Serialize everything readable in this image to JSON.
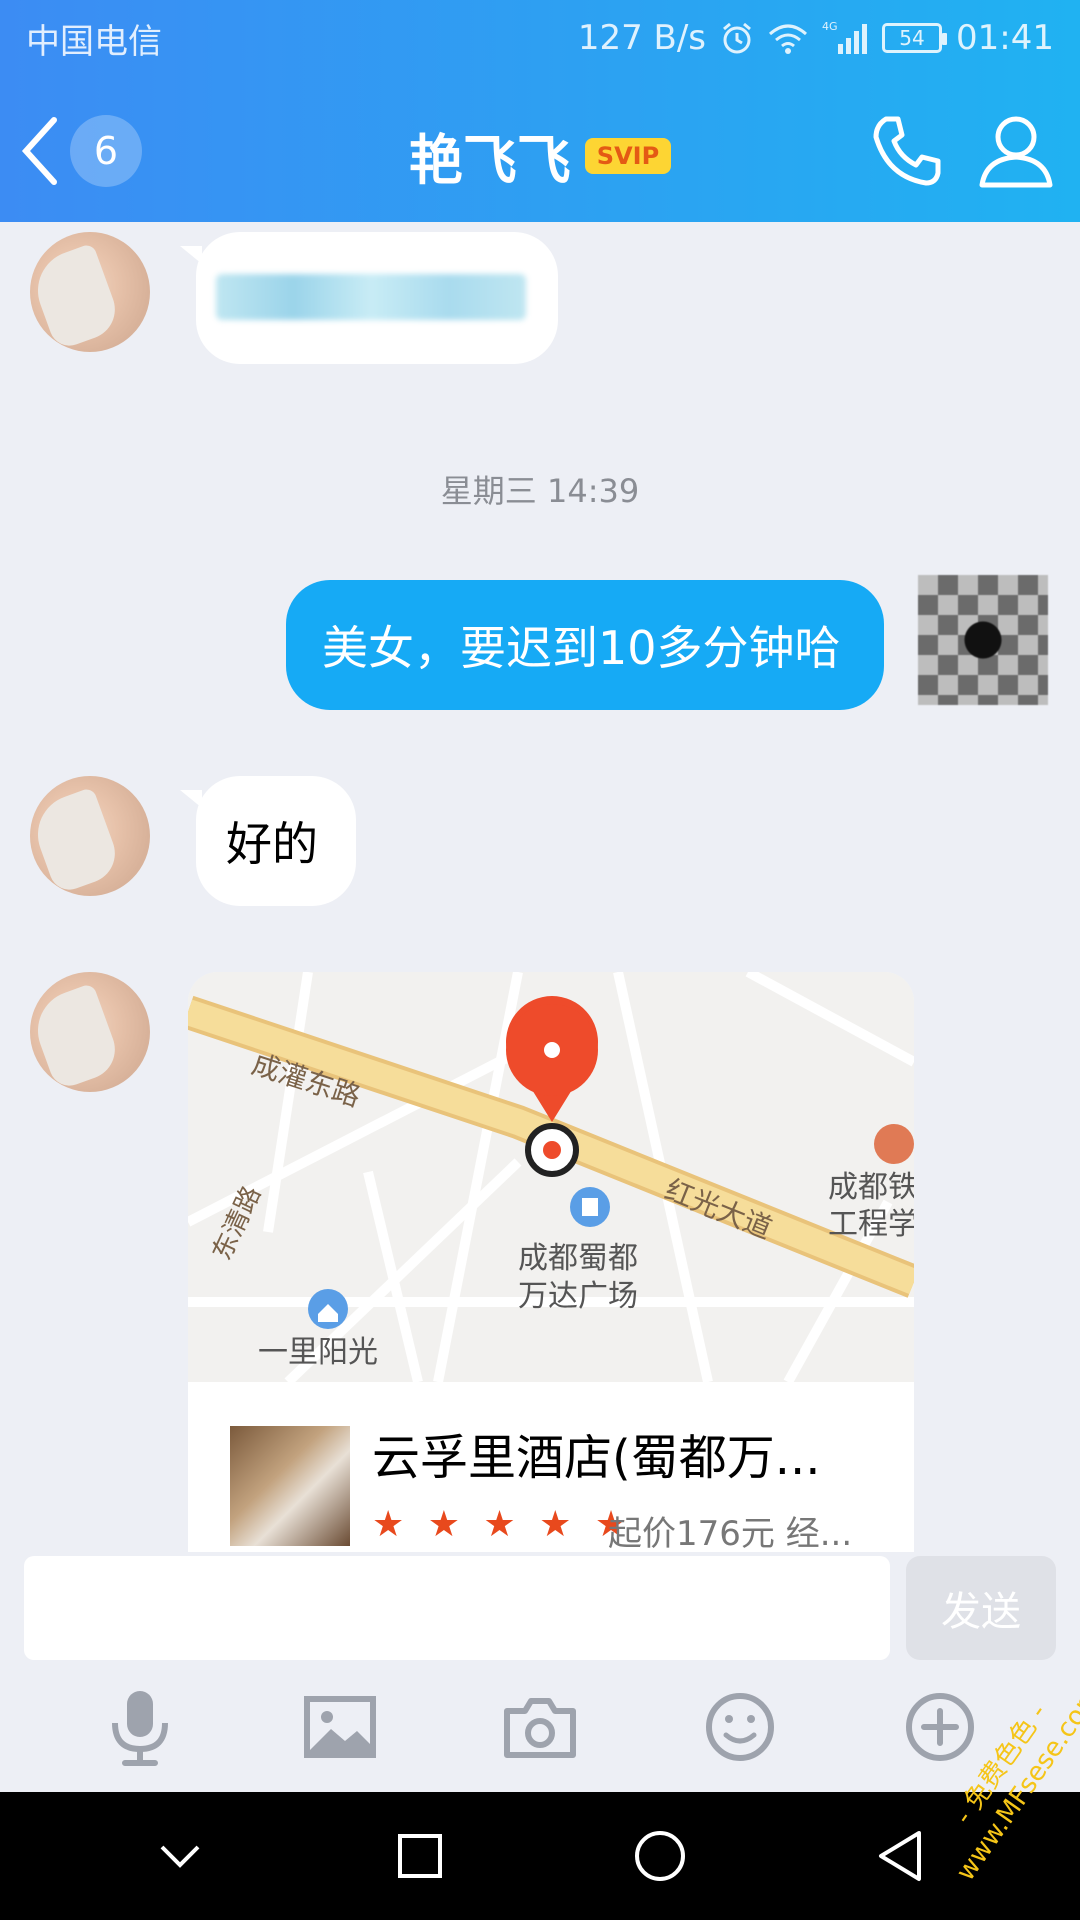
{
  "status_bar": {
    "carrier": "中国电信",
    "speed": "127 B/s",
    "network": "4G",
    "battery": "54",
    "time": "01:41"
  },
  "header": {
    "unread_count": "6",
    "contact_name": "艳飞飞",
    "badge": "SVIP",
    "icons": {
      "back": "chevron-left-icon",
      "call": "phone-icon",
      "profile": "person-icon"
    }
  },
  "chat": {
    "timestamp": "星期三 14:39",
    "messages": [
      {
        "side": "in",
        "text": ""
      },
      {
        "side": "out",
        "text": "美女，要迟到10多分钟哈"
      },
      {
        "side": "in",
        "text": "好的"
      }
    ],
    "location_card": {
      "map_labels": {
        "road_1": "成灌东路",
        "road_2": "红光大道",
        "road_3": "东清路",
        "poi_1": "成都蜀都\n万达广场",
        "poi_1_line1": "成都蜀都",
        "poi_1_line2": "万达广场",
        "poi_2": "一里阳光",
        "poi_3_line1": "成都铁",
        "poi_3_line2": "工程学"
      },
      "hotel_name": "云孚里酒店(蜀都万...",
      "stars": "★ ★ ★ ★ ★",
      "price": "起价176元 经..."
    }
  },
  "input": {
    "value": "",
    "send_label": "发送"
  },
  "toolbar": [
    "microphone-icon",
    "image-icon",
    "camera-icon",
    "emoji-icon",
    "plus-circle-icon"
  ],
  "navbar": [
    "chevron-down-icon",
    "square-icon",
    "circle-icon",
    "triangle-back-icon"
  ],
  "watermark": {
    "line1": "- 免费色色 -",
    "line2": "www.MFsese.com"
  },
  "colors": {
    "header_gradient_start": "#3c8cf3",
    "header_gradient_end": "#20b2f2",
    "outgoing_bubble": "#16aaf5",
    "map_pin": "#ee4b2b",
    "star": "#e8491d"
  }
}
